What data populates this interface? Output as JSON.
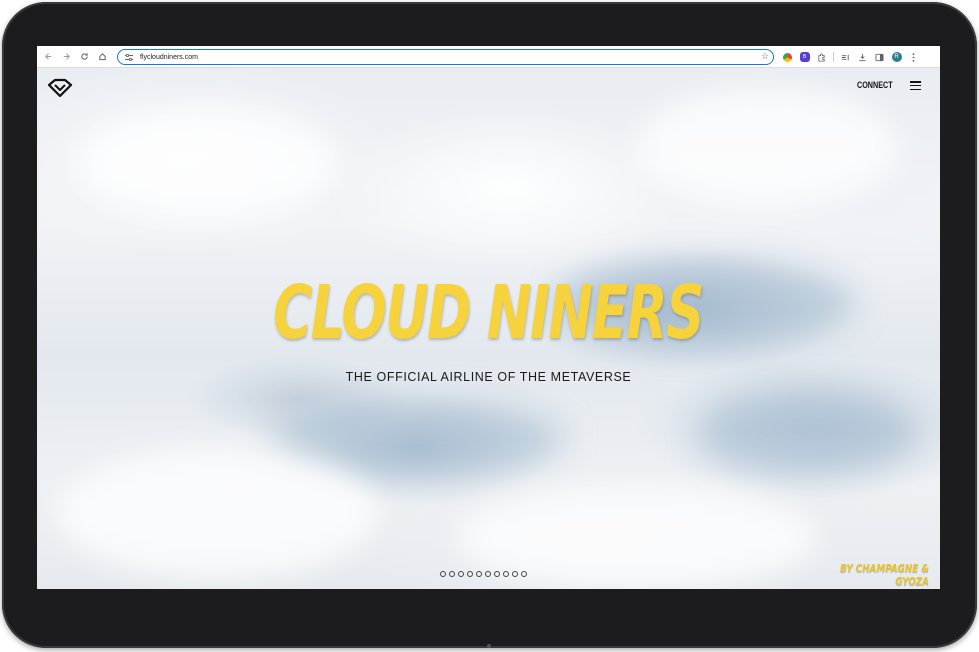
{
  "browser": {
    "url": "flycloudniners.com",
    "profile_initial": "R",
    "ext_badge": "B"
  },
  "nav": {
    "connect_label": "CONNECT"
  },
  "hero": {
    "title": "CLOUD NINERS",
    "subtitle": "THE OFFICIAL AIRLINE OF THE METAVERSE"
  },
  "slider": {
    "dot_count": 10,
    "active_index": null
  },
  "footer": {
    "byline": "BY CHAMPAGNE & GYOZA"
  },
  "colors": {
    "title_yellow": "#f6d23c",
    "byline_yellow": "#e8c330",
    "omnibox_focus": "#1a73e8"
  }
}
